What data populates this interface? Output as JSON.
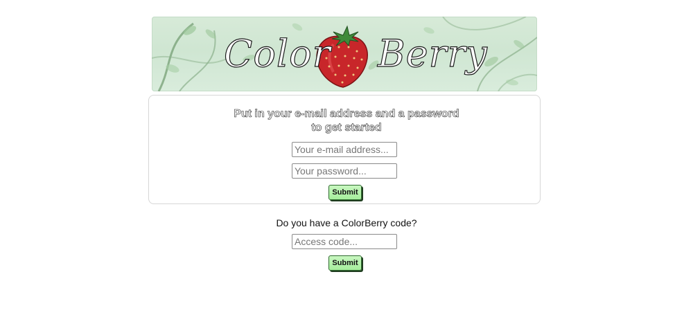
{
  "banner": {
    "logo_left": "Color",
    "logo_right": "Berry",
    "logo_icon": "strawberry-icon",
    "colors": {
      "background": "#d7ead8",
      "vine": "#6f9a6e",
      "leaf": "#9cc79a",
      "berry": "#c8262a",
      "berry_leaf": "#3f8a3a"
    }
  },
  "login": {
    "heading_line1": "Put in your e-mail address and a password",
    "heading_line2": "to get started",
    "email_placeholder": "Your e-mail address...",
    "password_placeholder": "Your password...",
    "submit_label": "Submit"
  },
  "access_code": {
    "question": "Do you have a ColorBerry code?",
    "code_placeholder": "Access code...",
    "submit_label": "Submit"
  },
  "theme": {
    "button_bg": "#b6f2ab",
    "button_border": "#2f6a2f",
    "card_border": "#d6d6d6"
  }
}
